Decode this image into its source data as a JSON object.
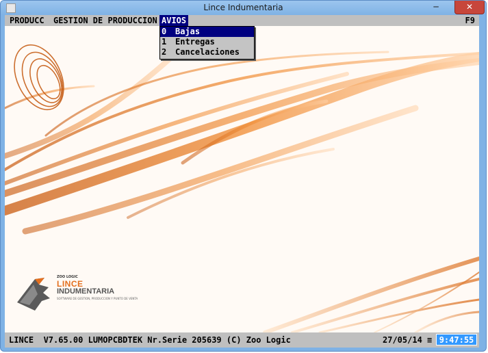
{
  "window": {
    "title": "Lince Indumentaria",
    "minimize_label": "─",
    "maximize_label": "□",
    "close_label": "✕"
  },
  "menubar": {
    "items": [
      "PRODUCC",
      "GESTION DE PRODUCCION",
      "AVIOS"
    ],
    "shortcut": "F9"
  },
  "dropdown": {
    "items": [
      {
        "key": "0",
        "label": "Bajas"
      },
      {
        "key": "1",
        "label": "Entregas"
      },
      {
        "key": "2",
        "label": "Cancelaciones"
      }
    ]
  },
  "logo": {
    "small": "ZOO LOGIC",
    "line1": "LINCE",
    "line2": "INDUMENTARIA",
    "tagline": "SOFTWARE DE GESTION, PRODUCCION Y PUNTO DE VENTA"
  },
  "statusbar": {
    "info": "LINCE  V7.65.00 LUMOPCBDTEK Nr.Serie 205639 (C) Zoo Logic",
    "date": "27/05/14",
    "menu_glyph": "≡",
    "time": "9:47:55"
  },
  "colors": {
    "accent": "#e36f1e",
    "menu_highlight": "#000080",
    "clock_bg": "#3399ff"
  }
}
